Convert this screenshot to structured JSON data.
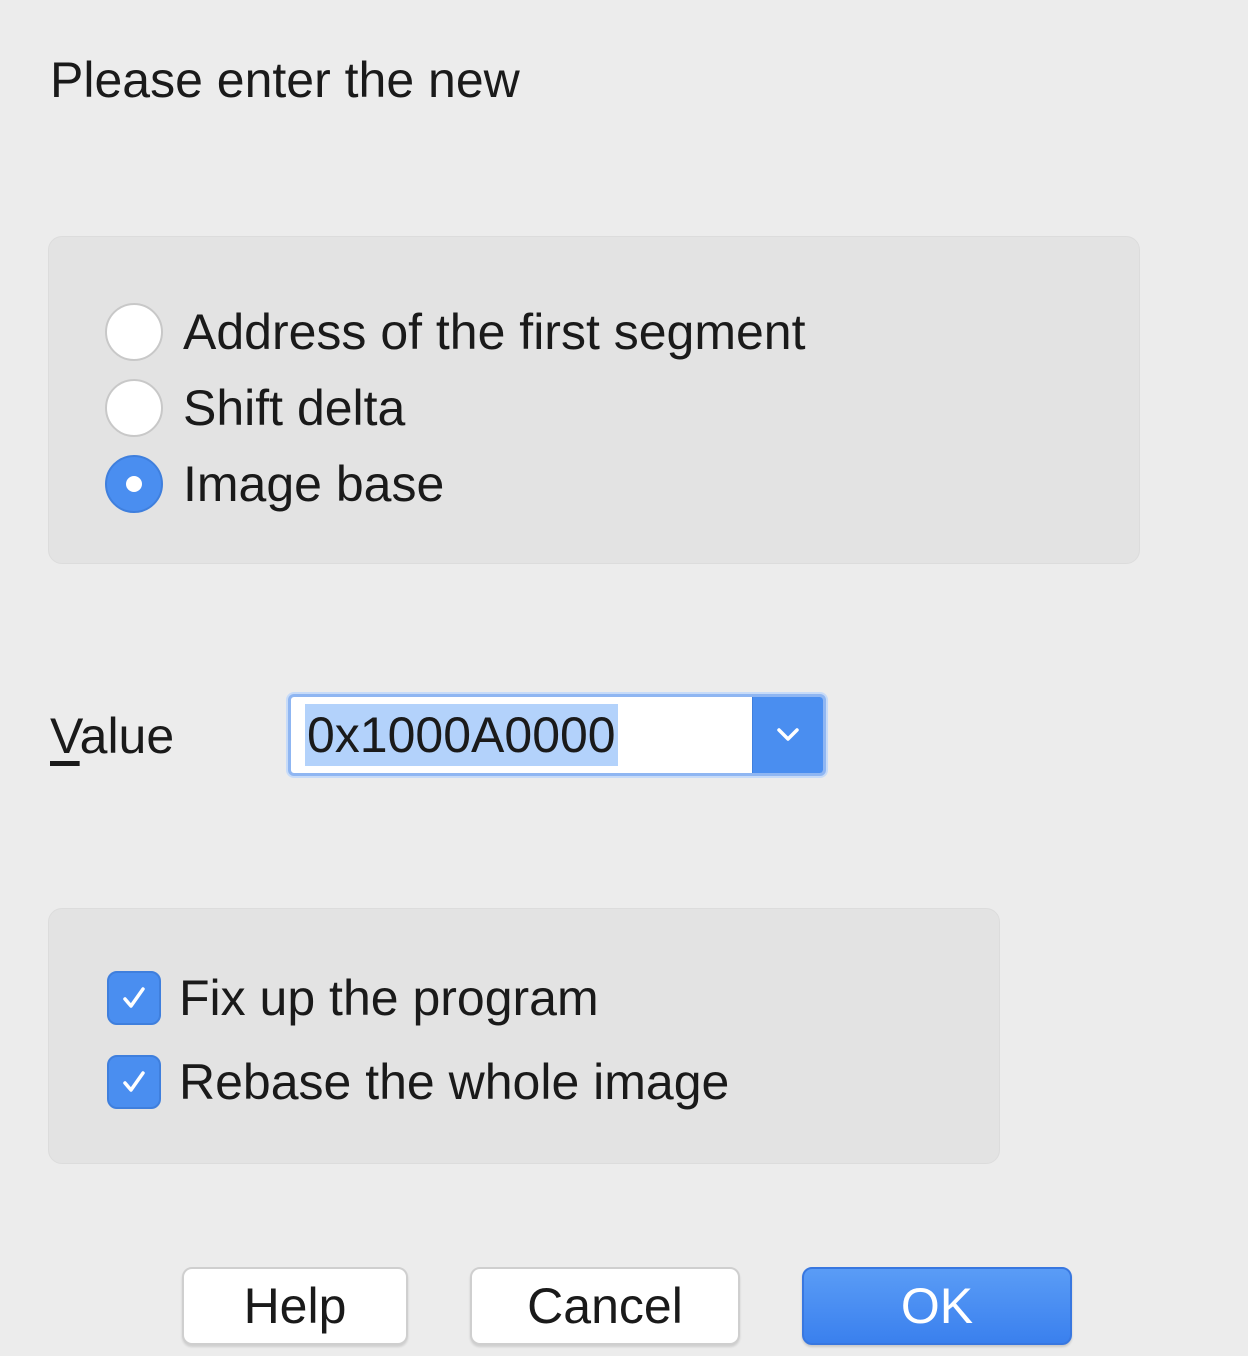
{
  "prompt": "Please enter the new",
  "mode_options": [
    {
      "label": "Address of the first segment",
      "checked": false
    },
    {
      "label": "Shift delta",
      "checked": false
    },
    {
      "label": "Image base",
      "checked": true
    }
  ],
  "value_field": {
    "label_mnemonic": "V",
    "label_rest": "alue",
    "value": "0x1000A0000"
  },
  "options": [
    {
      "label": "Fix up the program",
      "checked": true
    },
    {
      "label": "Rebase the whole image",
      "checked": true
    }
  ],
  "buttons": {
    "help": "Help",
    "cancel": "Cancel",
    "ok": "OK"
  },
  "colors": {
    "accent": "#4a8ef0",
    "background": "#ececec",
    "group_background": "#e3e3e3",
    "selection": "#b3d2fb"
  },
  "icons": {
    "combo_button": "chevron-down-icon",
    "checkbox_mark": "checkmark-icon"
  }
}
